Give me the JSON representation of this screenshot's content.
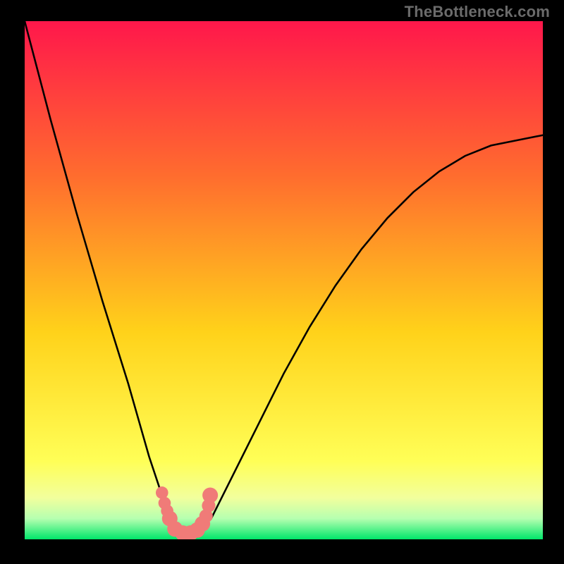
{
  "watermark": "TheBottleneck.com",
  "colors": {
    "background": "#000000",
    "gradient_top": "#ff174b",
    "gradient_quarter": "#ff6d2e",
    "gradient_mid": "#ffd21a",
    "gradient_low": "#ffff57",
    "gradient_base1": "#f2ff9d",
    "gradient_base2": "#b6ffb0",
    "gradient_bottom": "#00e66a",
    "curve": "#000000",
    "marker": "#f07b78"
  },
  "chart_data": {
    "type": "line",
    "title": "",
    "xlabel": "",
    "ylabel": "",
    "xlim": [
      0,
      100
    ],
    "ylim": [
      0,
      100
    ],
    "series": [
      {
        "name": "bottleneck-curve",
        "x": [
          0,
          5,
          10,
          15,
          20,
          22,
          24,
          26,
          28,
          29,
          30,
          31,
          32,
          33,
          34,
          36,
          38,
          40,
          45,
          50,
          55,
          60,
          65,
          70,
          75,
          80,
          85,
          90,
          95,
          100
        ],
        "y": [
          100,
          81,
          63,
          46,
          30,
          23,
          16,
          10,
          5,
          3,
          2,
          1,
          1,
          1,
          2,
          4,
          8,
          12,
          22,
          32,
          41,
          49,
          56,
          62,
          67,
          71,
          74,
          76,
          77,
          78
        ]
      }
    ],
    "markers": {
      "name": "highlight-points",
      "x": [
        26.5,
        27.0,
        27.5,
        28.0,
        29.0,
        30.5,
        32.0,
        33.3,
        34.3,
        35.0,
        35.5,
        35.8
      ],
      "y": [
        9.0,
        7.0,
        5.5,
        4.0,
        2.0,
        1.2,
        1.2,
        1.8,
        3.0,
        4.5,
        6.5,
        8.5
      ],
      "radius": [
        1.2,
        1.2,
        1.2,
        1.5,
        1.5,
        1.5,
        1.5,
        1.5,
        1.5,
        1.3,
        1.3,
        1.5
      ]
    }
  }
}
